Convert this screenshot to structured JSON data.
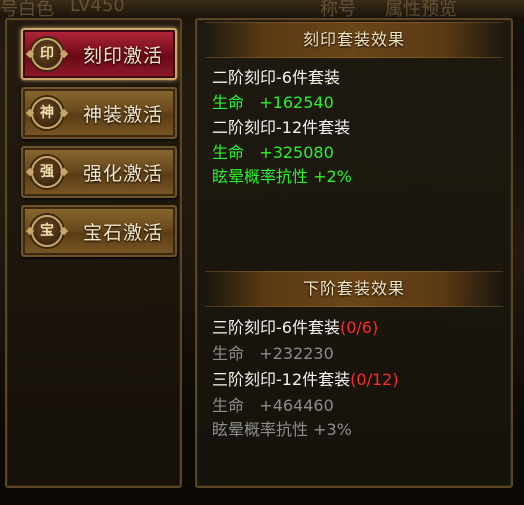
{
  "background": {
    "top_fragments": [
      "号白色",
      "LV450",
      "称号",
      "属性预览"
    ]
  },
  "tabs": [
    {
      "emblem": "印",
      "label": "刻印激活",
      "active": true
    },
    {
      "emblem": "神",
      "label": "神装激活",
      "active": false
    },
    {
      "emblem": "强",
      "label": "强化激活",
      "active": false
    },
    {
      "emblem": "宝",
      "label": "宝石激活",
      "active": false
    }
  ],
  "current_section": {
    "title": "刻印套装效果",
    "set1_name": "二阶刻印-6件套装",
    "set1_stat": "生命",
    "set1_value": "+162540",
    "set2_name": "二阶刻印-12件套装",
    "set2_stat": "生命",
    "set2_value": "+325080",
    "set2_extra": "眩晕概率抗性 +2%"
  },
  "next_section": {
    "title": "下阶套装效果",
    "set1_name": "三阶刻印-6件套装",
    "set1_progress": "(0/6)",
    "set1_stat": "生命",
    "set1_value": "+232230",
    "set2_name": "三阶刻印-12件套装",
    "set2_progress": "(0/12)",
    "set2_stat": "生命",
    "set2_value": "+464460",
    "set2_extra": "眩晕概率抗性 +3%"
  },
  "colors": {
    "active_tab": "#7a0e1c",
    "inactive_tab": "#6a4a1e",
    "bonus_green": "#2cf12c",
    "locked_grey": "#8c8c8c",
    "progress_red": "#ff2a2a"
  }
}
